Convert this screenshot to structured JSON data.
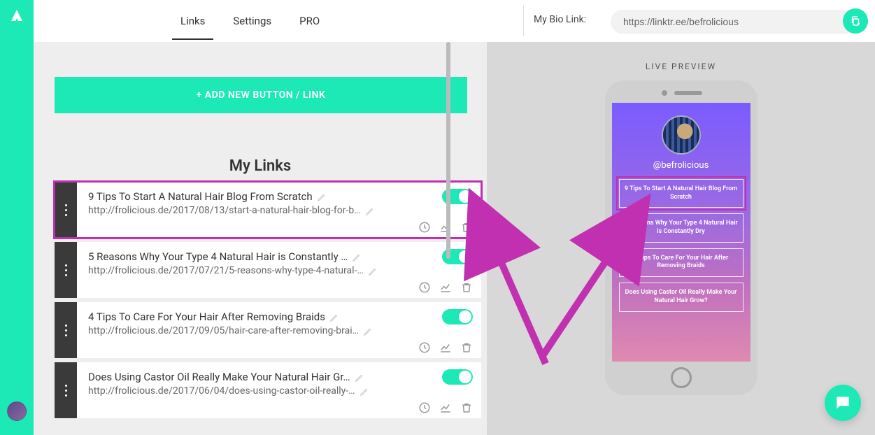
{
  "nav": {
    "tabs": [
      "Links",
      "Settings",
      "PRO"
    ],
    "active": 0
  },
  "biolink": {
    "label": "My Bio Link:",
    "url": "https://linktr.ee/befrolicious"
  },
  "add_button_label": "+ ADD NEW BUTTON / LINK",
  "section_title": "My Links",
  "links": [
    {
      "title": "9 Tips To Start A Natural Hair Blog From Scratch",
      "url": "http://frolicious.de/2017/08/13/start-a-natural-hair-blog-for-b…",
      "enabled": true,
      "selected": true
    },
    {
      "title": "5 Reasons Why Your Type 4 Natural Hair is Constantly …",
      "url": "http://frolicious.de/2017/07/21/5-reasons-why-type-4-natural-…",
      "enabled": true,
      "selected": false
    },
    {
      "title": "4 Tips To Care For Your Hair After Removing Braids",
      "url": "http://frolicious.de/2017/09/05/hair-care-after-removing-brai…",
      "enabled": true,
      "selected": false
    },
    {
      "title": "Does Using Castor Oil Really Make Your Natural Hair Gr…",
      "url": "http://frolicious.de/2017/06/04/does-using-castor-oil-really-…",
      "enabled": true,
      "selected": false
    }
  ],
  "preview": {
    "label": "LIVE PREVIEW",
    "handle": "@befrolicious",
    "buttons": [
      "9 Tips To Start A Natural Hair Blog From Scratch",
      "5 Reasons Why Your Type 4 Natural Hair is Constantly Dry",
      "4 Tips To Care For Your Hair After Removing Braids",
      "Does Using Castor Oil Really Make Your Natural Hair Grow?"
    ]
  },
  "colors": {
    "accent": "#1de9b6",
    "highlight": "#c030b0"
  }
}
